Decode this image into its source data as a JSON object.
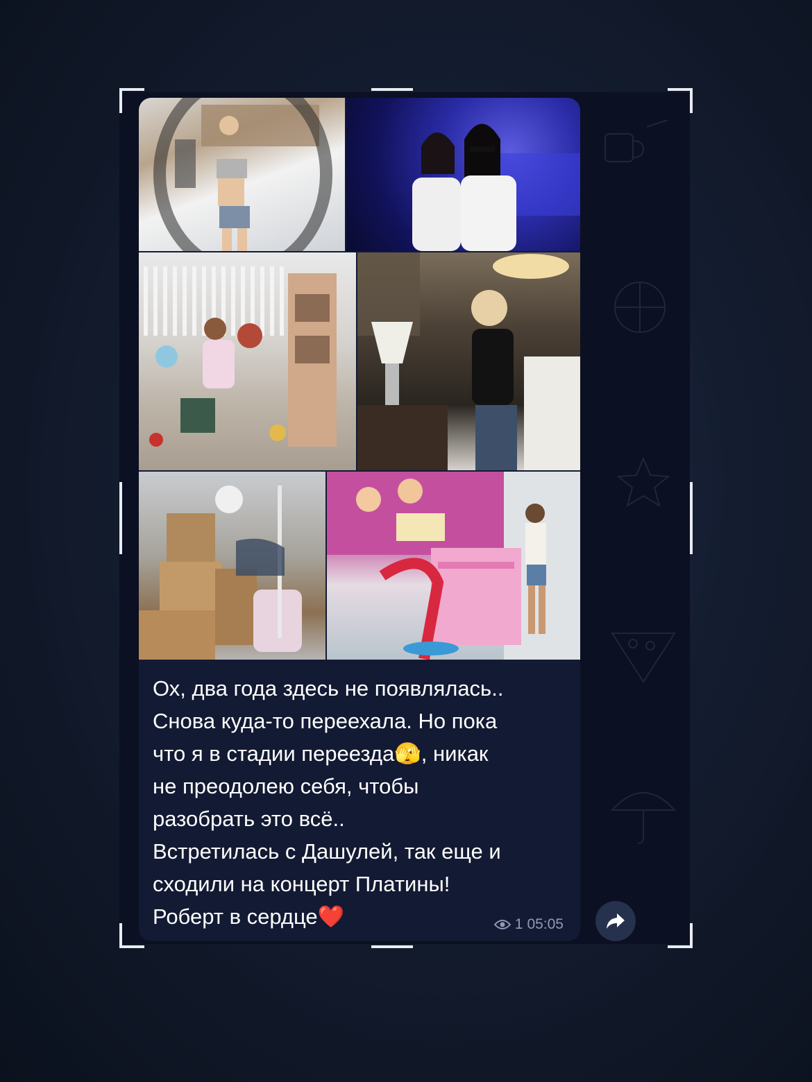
{
  "message": {
    "text": "Ох, два года здесь не появлялась..\nСнова куда-то переехала. Но пока\nчто я в стадии переезда🫣, никак\nне преодолею себя, чтобы\nразобрать это всё..\nВстретилась с Дашулей, так еще и\nсходили на концерт Платины!\nРоберт в сердце❤️",
    "views": "1",
    "time": "05:05"
  },
  "icons": {
    "views": "eye-icon",
    "share": "share-arrow-icon"
  },
  "colors": {
    "bubble": "#131a33",
    "panel": "#0b1022",
    "meta_text": "#8f9bb5",
    "share_button": "#26314d"
  }
}
